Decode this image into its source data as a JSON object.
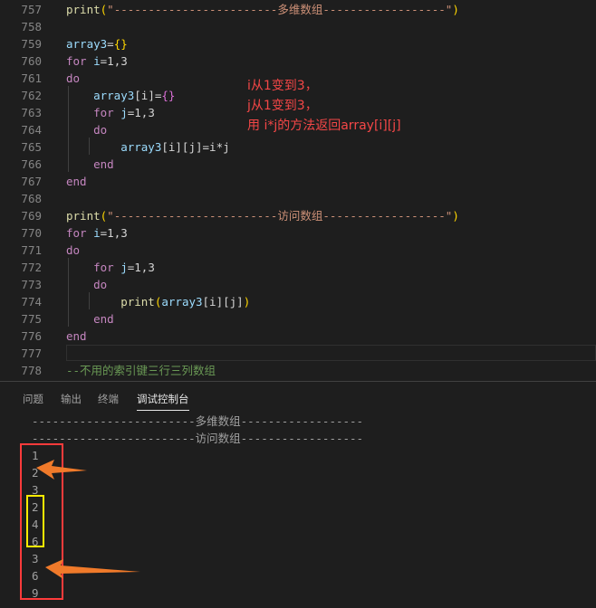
{
  "editor": {
    "lines": [
      {
        "n": "757",
        "tokens": [
          {
            "t": "print",
            "c": "#dcdcaa"
          },
          {
            "t": "(",
            "c": "#ffd700"
          },
          {
            "t": "\"------------------------多维数组------------------\"",
            "c": "#ce9178"
          },
          {
            "t": ")",
            "c": "#ffd700"
          }
        ]
      },
      {
        "n": "758",
        "tokens": []
      },
      {
        "n": "759",
        "tokens": [
          {
            "t": "array3",
            "c": "#9cdcfe"
          },
          {
            "t": "=",
            "c": "#d4d4d4"
          },
          {
            "t": "{}",
            "c": "#ffd700"
          }
        ]
      },
      {
        "n": "760",
        "tokens": [
          {
            "t": "for",
            "c": "#c586c0"
          },
          {
            "t": " i",
            "c": "#9cdcfe"
          },
          {
            "t": "=1,3",
            "c": "#d4d4d4"
          }
        ]
      },
      {
        "n": "761",
        "tokens": [
          {
            "t": "do",
            "c": "#c586c0"
          }
        ]
      },
      {
        "n": "762",
        "tokens": [
          {
            "t": "    array3",
            "c": "#9cdcfe"
          },
          {
            "t": "[i]",
            "c": "#d4d4d4"
          },
          {
            "t": "=",
            "c": "#d4d4d4"
          },
          {
            "t": "{}",
            "c": "#da70d6"
          }
        ]
      },
      {
        "n": "763",
        "tokens": [
          {
            "t": "    for",
            "c": "#c586c0"
          },
          {
            "t": " j",
            "c": "#9cdcfe"
          },
          {
            "t": "=1,3",
            "c": "#d4d4d4"
          }
        ]
      },
      {
        "n": "764",
        "tokens": [
          {
            "t": "    do",
            "c": "#c586c0"
          }
        ]
      },
      {
        "n": "765",
        "tokens": [
          {
            "t": "        array3",
            "c": "#9cdcfe"
          },
          {
            "t": "[i][j]=i*j",
            "c": "#d4d4d4"
          }
        ]
      },
      {
        "n": "766",
        "tokens": [
          {
            "t": "    end",
            "c": "#c586c0"
          }
        ]
      },
      {
        "n": "767",
        "tokens": [
          {
            "t": "end",
            "c": "#c586c0"
          }
        ]
      },
      {
        "n": "768",
        "tokens": []
      },
      {
        "n": "769",
        "tokens": [
          {
            "t": "print",
            "c": "#dcdcaa"
          },
          {
            "t": "(",
            "c": "#ffd700"
          },
          {
            "t": "\"------------------------访问数组------------------\"",
            "c": "#ce9178"
          },
          {
            "t": ")",
            "c": "#ffd700"
          }
        ]
      },
      {
        "n": "770",
        "tokens": [
          {
            "t": "for",
            "c": "#c586c0"
          },
          {
            "t": " i",
            "c": "#9cdcfe"
          },
          {
            "t": "=1,3",
            "c": "#d4d4d4"
          }
        ]
      },
      {
        "n": "771",
        "tokens": [
          {
            "t": "do",
            "c": "#c586c0"
          }
        ]
      },
      {
        "n": "772",
        "tokens": [
          {
            "t": "    for",
            "c": "#c586c0"
          },
          {
            "t": " j",
            "c": "#9cdcfe"
          },
          {
            "t": "=1,3",
            "c": "#d4d4d4"
          }
        ]
      },
      {
        "n": "773",
        "tokens": [
          {
            "t": "    do",
            "c": "#c586c0"
          }
        ]
      },
      {
        "n": "774",
        "tokens": [
          {
            "t": "        print",
            "c": "#dcdcaa"
          },
          {
            "t": "(",
            "c": "#ffd700"
          },
          {
            "t": "array3",
            "c": "#9cdcfe"
          },
          {
            "t": "[i][j]",
            "c": "#d4d4d4"
          },
          {
            "t": ")",
            "c": "#ffd700"
          }
        ]
      },
      {
        "n": "775",
        "tokens": [
          {
            "t": "    end",
            "c": "#c586c0"
          }
        ]
      },
      {
        "n": "776",
        "tokens": [
          {
            "t": "end",
            "c": "#c586c0"
          }
        ]
      },
      {
        "n": "777",
        "tokens": []
      },
      {
        "n": "778",
        "tokens": [
          {
            "t": "--不用的索引键三行三列数组",
            "c": "#6a9955"
          }
        ]
      }
    ],
    "annotation": [
      "i从1变到3，",
      "j从1变到3，",
      "用 i*j的方法返回array[i][j]"
    ]
  },
  "panel": {
    "tabs": [
      {
        "label": "问题",
        "active": false
      },
      {
        "label": "输出",
        "active": false
      },
      {
        "label": "终端",
        "active": false
      },
      {
        "label": "调试控制台",
        "active": true
      }
    ],
    "output": [
      "------------------------多维数组------------------",
      "------------------------访问数组------------------",
      "1",
      "2",
      "3",
      "2",
      "4",
      "6",
      "3",
      "6",
      "9"
    ]
  },
  "colors": {
    "annotation": "#f44747",
    "red_box": "#ff3b3b",
    "yellow_box": "#ffeb00",
    "arrow": "#f07a2a"
  }
}
